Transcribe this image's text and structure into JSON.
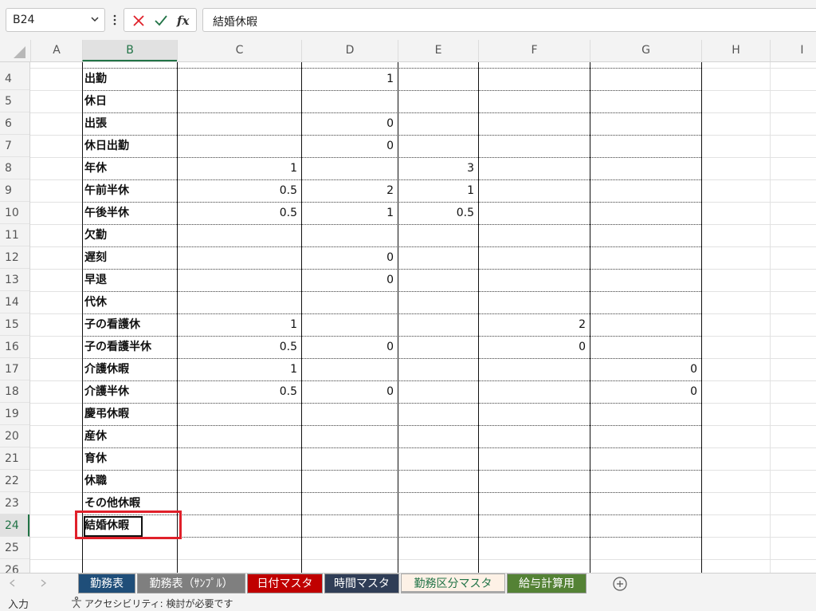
{
  "formula_bar": {
    "name_box": "B24",
    "formula": "結婚休暇"
  },
  "columns": [
    "A",
    "B",
    "C",
    "D",
    "E",
    "F",
    "G",
    "H",
    "I"
  ],
  "selected_column": "B",
  "rows": [
    {
      "num": "4",
      "label": "出勤",
      "C": "",
      "D": "1",
      "E": "",
      "F": "",
      "G": ""
    },
    {
      "num": "5",
      "label": "休日",
      "C": "",
      "D": "",
      "E": "",
      "F": "",
      "G": ""
    },
    {
      "num": "6",
      "label": "出張",
      "C": "",
      "D": "0",
      "E": "",
      "F": "",
      "G": ""
    },
    {
      "num": "7",
      "label": "休日出勤",
      "C": "",
      "D": "0",
      "E": "",
      "F": "",
      "G": ""
    },
    {
      "num": "8",
      "label": "年休",
      "C": "1",
      "D": "",
      "E": "3",
      "F": "",
      "G": ""
    },
    {
      "num": "9",
      "label": "午前半休",
      "C": "0.5",
      "D": "2",
      "E": "1",
      "F": "",
      "G": ""
    },
    {
      "num": "10",
      "label": "午後半休",
      "C": "0.5",
      "D": "1",
      "E": "0.5",
      "F": "",
      "G": ""
    },
    {
      "num": "11",
      "label": "欠勤",
      "C": "",
      "D": "",
      "E": "",
      "F": "",
      "G": ""
    },
    {
      "num": "12",
      "label": "遅刻",
      "C": "",
      "D": "0",
      "E": "",
      "F": "",
      "G": ""
    },
    {
      "num": "13",
      "label": "早退",
      "C": "",
      "D": "0",
      "E": "",
      "F": "",
      "G": ""
    },
    {
      "num": "14",
      "label": "代休",
      "C": "",
      "D": "",
      "E": "",
      "F": "",
      "G": ""
    },
    {
      "num": "15",
      "label": "子の看護休",
      "C": "1",
      "D": "",
      "E": "",
      "F": "2",
      "G": ""
    },
    {
      "num": "16",
      "label": "子の看護半休",
      "C": "0.5",
      "D": "0",
      "E": "",
      "F": "0",
      "G": ""
    },
    {
      "num": "17",
      "label": "介護休暇",
      "C": "1",
      "D": "",
      "E": "",
      "F": "",
      "G": "0"
    },
    {
      "num": "18",
      "label": "介護半休",
      "C": "0.5",
      "D": "0",
      "E": "",
      "F": "",
      "G": "0"
    },
    {
      "num": "19",
      "label": "慶弔休暇",
      "C": "",
      "D": "",
      "E": "",
      "F": "",
      "G": ""
    },
    {
      "num": "20",
      "label": "産休",
      "C": "",
      "D": "",
      "E": "",
      "F": "",
      "G": ""
    },
    {
      "num": "21",
      "label": "育休",
      "C": "",
      "D": "",
      "E": "",
      "F": "",
      "G": ""
    },
    {
      "num": "22",
      "label": "休職",
      "C": "",
      "D": "",
      "E": "",
      "F": "",
      "G": ""
    },
    {
      "num": "23",
      "label": "その他休暇",
      "C": "",
      "D": "",
      "E": "",
      "F": "",
      "G": ""
    },
    {
      "num": "24",
      "label": "結婚休暇",
      "C": "",
      "D": "",
      "E": "",
      "F": "",
      "G": ""
    },
    {
      "num": "25",
      "label": "",
      "C": "",
      "D": "",
      "E": "",
      "F": "",
      "G": ""
    },
    {
      "num": "26",
      "label": "",
      "C": "",
      "D": "",
      "E": "",
      "F": "",
      "G": ""
    }
  ],
  "selected_row": "24",
  "sheet_tabs": [
    {
      "label": "勤務表",
      "bg": "#1f4e79",
      "fg": "#ffffff",
      "active": false
    },
    {
      "label": "勤務表（ｻﾝﾌﾟﾙ）",
      "bg": "#7f7f7f",
      "fg": "#ffffff",
      "active": false
    },
    {
      "label": "日付マスタ",
      "bg": "#c00000",
      "fg": "#ffffff",
      "active": false
    },
    {
      "label": "時間マスタ",
      "bg": "#2f3d56",
      "fg": "#ffffff",
      "active": false
    },
    {
      "label": "勤務区分マスタ",
      "bg": "#fdf1e6",
      "fg": "#217346",
      "active": true
    },
    {
      "label": "給与計算用",
      "bg": "#548235",
      "fg": "#ffffff",
      "active": false
    }
  ],
  "status_bar": {
    "mode": "入力",
    "accessibility": "アクセシビリティ: 検討が必要です"
  },
  "icons": {
    "cancel": "x-icon",
    "enter": "check-icon",
    "function": "fx-icon",
    "add_sheet": "plus-circle-icon",
    "accessibility": "accessibility-icon"
  },
  "colors": {
    "highlight": "#e0202a",
    "selection_green": "#217346"
  }
}
